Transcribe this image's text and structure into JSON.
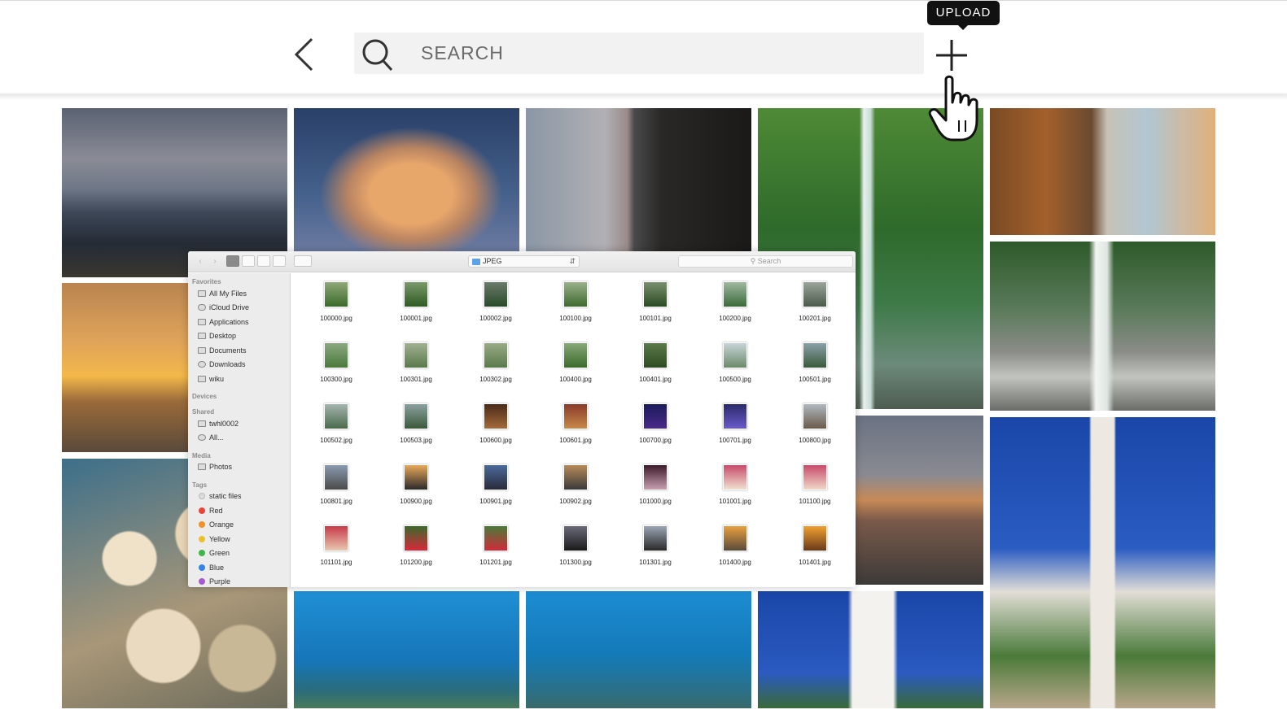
{
  "header": {
    "search_placeholder": "SEARCH",
    "upload_tooltip": "UPLOAD"
  },
  "finder": {
    "path_label": "JPEG",
    "search_placeholder": "Search",
    "sidebar": {
      "favorites_title": "Favorites",
      "favorites": [
        "All My Files",
        "iCloud Drive",
        "Applications",
        "Desktop",
        "Documents",
        "Downloads",
        "wiku"
      ],
      "devices_title": "Devices",
      "shared_title": "Shared",
      "shared": [
        "twhl0002",
        "All..."
      ],
      "media_title": "Media",
      "media": [
        "Photos"
      ],
      "tags_title": "Tags",
      "tags": [
        {
          "label": "static files",
          "color": "#d8d8d8"
        },
        {
          "label": "Red",
          "color": "#e8443a"
        },
        {
          "label": "Orange",
          "color": "#f0902a"
        },
        {
          "label": "Yellow",
          "color": "#e9c12c"
        },
        {
          "label": "Green",
          "color": "#3fb64a"
        },
        {
          "label": "Blue",
          "color": "#3483e8"
        },
        {
          "label": "Purple",
          "color": "#a65ad0"
        }
      ]
    },
    "files": [
      "100000.jpg",
      "100001.jpg",
      "100002.jpg",
      "100100.jpg",
      "100101.jpg",
      "100200.jpg",
      "100201.jpg",
      "100300.jpg",
      "100301.jpg",
      "100302.jpg",
      "100400.jpg",
      "100401.jpg",
      "100500.jpg",
      "100501.jpg",
      "100502.jpg",
      "100503.jpg",
      "100600.jpg",
      "100601.jpg",
      "100700.jpg",
      "100701.jpg",
      "100800.jpg",
      "100801.jpg",
      "100900.jpg",
      "100901.jpg",
      "100902.jpg",
      "101000.jpg",
      "101001.jpg",
      "101100.jpg",
      "101101.jpg",
      "101200.jpg",
      "101201.jpg",
      "101300.jpg",
      "101301.jpg",
      "101400.jpg",
      "101401.jpg"
    ]
  },
  "colors": {
    "tooltip_bg": "#111111",
    "search_bg": "#f2f2f2",
    "finder_selected_view": "#8a8a8a"
  }
}
